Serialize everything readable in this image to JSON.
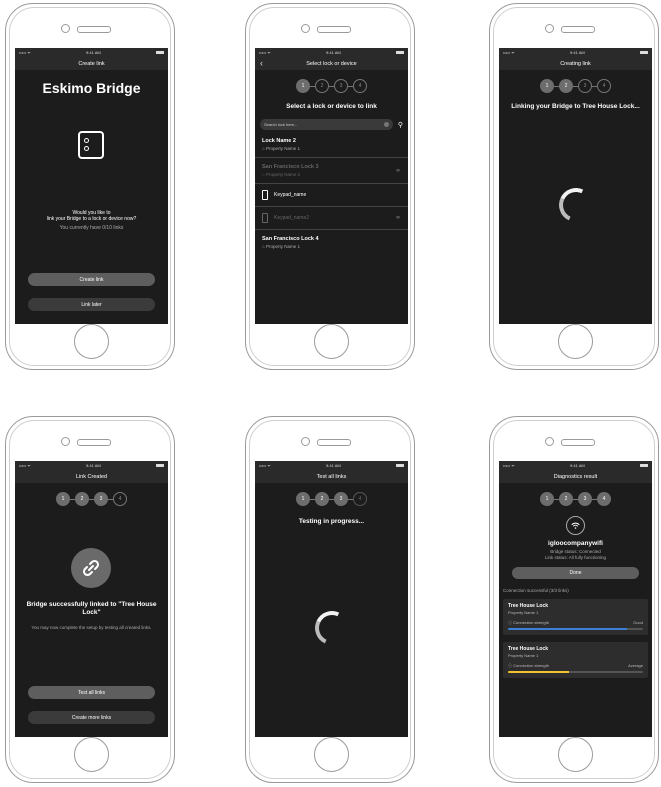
{
  "status_bar": {
    "carrier": "••••• ᯤ",
    "time": "9:41 AM"
  },
  "screen1": {
    "title": "Create link",
    "heading": "Eskimo Bridge",
    "question_line1": "Would you like to",
    "question_line2": "link your Bridge to a lock or device now?",
    "links_info": "You currently have 0/10 links",
    "create_link_label": "Create link",
    "link_later_label": "Link later"
  },
  "screen2": {
    "title": "Select lock or device",
    "steps": [
      "1",
      "2",
      "3",
      "4"
    ],
    "heading": "Select a lock or device to link",
    "search_placeholder": "Search lock here...",
    "items": [
      {
        "title": "Lock Name 2",
        "sub": "Property Name 1"
      },
      {
        "title": "San Francisco Lock 3",
        "sub": "Property Name 2"
      },
      {
        "title": "Keypad_name"
      },
      {
        "title": "Keypad_name2"
      },
      {
        "title": "San Francisco Lock 4",
        "sub": "Property Name 1"
      }
    ]
  },
  "screen3": {
    "title": "Creating link",
    "steps": [
      "1",
      "2",
      "3",
      "4"
    ],
    "message": "Linking your Bridge to Tree House Lock..."
  },
  "screen4": {
    "title": "Link Created",
    "steps": [
      "1",
      "2",
      "3",
      "4"
    ],
    "message": "Bridge successfully linked to \"Tree House Lock\"",
    "sub": "You may now complete the setup by testing all created links.",
    "test_all_label": "Test all links",
    "create_more_label": "Create more links"
  },
  "screen5": {
    "title": "Test all links",
    "steps": [
      "1",
      "2",
      "3",
      "4"
    ],
    "message": "Testing in progress..."
  },
  "screen6": {
    "title": "Diagnostics result",
    "steps": [
      "1",
      "2",
      "3",
      "4"
    ],
    "wifi_name": "igloocompanywifi",
    "bridge_status": "Bridge status: Connected",
    "link_status": "Link status: All fully functioning",
    "done_label": "Done",
    "summary": "Connection successful (3/3 links)",
    "cards": [
      {
        "title": "Tree House Lock",
        "sub": "Property Name 1",
        "label": "Connection strength",
        "value": "Good",
        "strength": 0.88,
        "color": "#3b7fd6"
      },
      {
        "title": "Tree House Lock",
        "sub": "Property Name 1",
        "label": "Connection strength",
        "value": "Average",
        "strength": 0.45,
        "color": "#f2c230"
      }
    ]
  }
}
